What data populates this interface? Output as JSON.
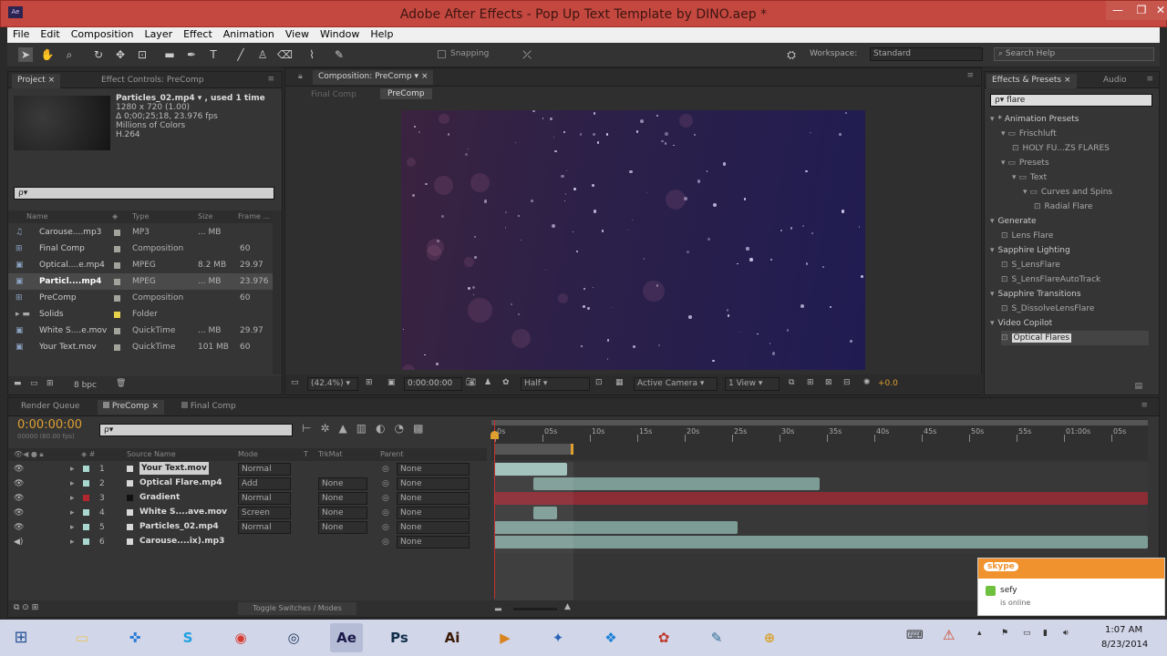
{
  "window": {
    "title": "Adobe After Effects - Pop Up Text Template by DINO.aep *",
    "minimize": "—",
    "maximize": "❐",
    "close": "✕",
    "app_icon": "Ae"
  },
  "menu": [
    "File",
    "Edit",
    "Composition",
    "Layer",
    "Effect",
    "Animation",
    "View",
    "Window",
    "Help"
  ],
  "toolbar": {
    "snapping": "Snapping",
    "workspace_label": "Workspace:",
    "workspace_value": "Standard",
    "search_placeholder": "Search Help"
  },
  "project": {
    "tab": "Project",
    "effect_controls": "Effect Controls: PreComp",
    "preview_info": [
      "Particles_02.mp4 ▾ , used 1 time",
      "1280 x 720 (1.00)",
      "Δ 0;00;25;18, 23.976 fps",
      "Millions of Colors",
      "H.264"
    ],
    "search_placeholder": "ρ▾",
    "columns": [
      "Name",
      "Type",
      "Size",
      "Frame ..."
    ],
    "items": [
      {
        "name": "Carouse....mp3",
        "type": "MP3",
        "size": "... MB",
        "fps": "",
        "color": "#a2a39a",
        "icon": "audio"
      },
      {
        "name": "Final Comp",
        "type": "Composition",
        "size": "",
        "fps": "60",
        "color": "#a2a39a",
        "icon": "comp"
      },
      {
        "name": "Optical....e.mp4",
        "type": "MPEG",
        "size": "8.2 MB",
        "fps": "29.97",
        "color": "#a2a39a",
        "icon": "video"
      },
      {
        "name": "Particl....mp4",
        "type": "MPEG",
        "size": "... MB",
        "fps": "23.976",
        "color": "#a2a39a",
        "icon": "video"
      },
      {
        "name": "PreComp",
        "type": "Composition",
        "size": "",
        "fps": "60",
        "color": "#a2a39a",
        "icon": "comp"
      },
      {
        "name": "Solids",
        "type": "Folder",
        "size": "",
        "fps": "",
        "color": "#e6d24a",
        "icon": "folder"
      },
      {
        "name": "White S....e.mov",
        "type": "QuickTime",
        "size": "... MB",
        "fps": "29.97",
        "color": "#a2a39a",
        "icon": "video"
      },
      {
        "name": "Your Text.mov",
        "type": "QuickTime",
        "size": "101 MB",
        "fps": "60",
        "color": "#a2a39a",
        "icon": "video"
      }
    ],
    "bpc": "8 bpc"
  },
  "composition": {
    "tab": "Composition: PreComp",
    "sub_tabs": [
      "Final Comp",
      "PreComp"
    ],
    "zoom": "(42.4%)",
    "timecode": "0:00:00:00",
    "resolution": "Half",
    "camera": "Active Camera",
    "views": "1 View",
    "exposure": "+0.0"
  },
  "effects": {
    "tab": "Effects & Presets",
    "audio_tab": "Audio",
    "search_value": "flare",
    "tree": [
      {
        "label": "* Animation Presets",
        "indent": 0,
        "kind": "group"
      },
      {
        "label": "Frischluft",
        "indent": 1,
        "kind": "folder"
      },
      {
        "label": "HOLY FU...ZS FLARES",
        "indent": 2,
        "kind": "preset"
      },
      {
        "label": "Presets",
        "indent": 1,
        "kind": "folder"
      },
      {
        "label": "Text",
        "indent": 2,
        "kind": "folder"
      },
      {
        "label": "Curves and Spins",
        "indent": 3,
        "kind": "folder"
      },
      {
        "label": "Radial Flare",
        "indent": 4,
        "kind": "preset"
      },
      {
        "label": "Generate",
        "indent": 0,
        "kind": "group"
      },
      {
        "label": "Lens Flare",
        "indent": 1,
        "kind": "effect"
      },
      {
        "label": "Sapphire Lighting",
        "indent": 0,
        "kind": "group"
      },
      {
        "label": "S_LensFlare",
        "indent": 1,
        "kind": "effect"
      },
      {
        "label": "S_LensFlareAutoTrack",
        "indent": 1,
        "kind": "effect"
      },
      {
        "label": "Sapphire Transitions",
        "indent": 0,
        "kind": "group"
      },
      {
        "label": "S_DissolveLensFlare",
        "indent": 1,
        "kind": "effect"
      },
      {
        "label": "Video Copilot",
        "indent": 0,
        "kind": "group"
      },
      {
        "label": "Optical Flares",
        "indent": 1,
        "kind": "effect",
        "selected": true
      }
    ]
  },
  "timeline": {
    "tabs": [
      "Render Queue",
      "PreComp",
      "Final Comp"
    ],
    "timecode": "0:00:00:00",
    "fps_note": "00000 (60.00 fps)",
    "columns": [
      "Source Name",
      "Mode",
      "T",
      "TrkMat",
      "Parent"
    ],
    "ruler": [
      "0s",
      "05s",
      "10s",
      "15s",
      "20s",
      "25s",
      "30s",
      "35s",
      "40s",
      "45s",
      "50s",
      "55s",
      "01:00s",
      "05s"
    ],
    "layers": [
      {
        "num": "1",
        "name": "Your Text.mov",
        "mode": "Normal",
        "trkmat": "",
        "parent": "None",
        "label": "#a8d7cf",
        "start": 0.0,
        "end": 0.115,
        "bar": "#9fbfbb"
      },
      {
        "num": "2",
        "name": "Optical Flare.mp4",
        "mode": "Add",
        "trkmat": "None",
        "parent": "None",
        "label": "#a8d7cf",
        "start": 0.06,
        "end": 0.5,
        "bar": "#7e9c96"
      },
      {
        "num": "3",
        "name": "Gradient",
        "mode": "Normal",
        "trkmat": "None",
        "parent": "None",
        "label": "#b3262e",
        "start": 0.0,
        "end": 1.0,
        "bar": "#8c2c35"
      },
      {
        "num": "4",
        "name": "White S....ave.mov",
        "mode": "Screen",
        "trkmat": "None",
        "parent": "None",
        "label": "#a8d7cf",
        "start": 0.06,
        "end": 0.1,
        "bar": "#7e9c96"
      },
      {
        "num": "5",
        "name": "Particles_02.mp4",
        "mode": "Normal",
        "trkmat": "None",
        "parent": "None",
        "label": "#a8d7cf",
        "start": 0.0,
        "end": 0.375,
        "bar": "#7e9c96"
      },
      {
        "num": "6",
        "name": "Carouse....ix).mp3",
        "mode": "",
        "trkmat": "",
        "parent": "None",
        "label": "#a8d7cf",
        "start": -0.01,
        "end": 1.0,
        "bar": "#7e9c96"
      }
    ],
    "toggle": "Toggle Switches / Modes"
  },
  "skype": {
    "logo": "skype",
    "user": "sefy",
    "status": "is online"
  },
  "taskbar": {
    "time": "1:07 AM",
    "date": "8/23/2014",
    "apps": [
      {
        "name": "folder-icon",
        "g": "▭",
        "c": "#e9c55b"
      },
      {
        "name": "sniper-icon",
        "g": "✜",
        "c": "#2b7bd6"
      },
      {
        "name": "skype-icon",
        "g": "S",
        "c": "#1fa0e3"
      },
      {
        "name": "chrome-icon",
        "g": "◉",
        "c": "#d83b2f"
      },
      {
        "name": "cinema4d-icon",
        "g": "◎",
        "c": "#22395e"
      },
      {
        "name": "aftereffects-icon",
        "g": "Ae",
        "c": "#1a1847"
      },
      {
        "name": "photoshop-icon",
        "g": "Ps",
        "c": "#0f2d4a"
      },
      {
        "name": "illustrator-icon",
        "g": "Ai",
        "c": "#3b1a08"
      },
      {
        "name": "media-player-icon",
        "g": "▶",
        "c": "#d9841f"
      },
      {
        "name": "bird-icon",
        "g": "✦",
        "c": "#2a64b8"
      },
      {
        "name": "dropbox-icon",
        "g": "❖",
        "c": "#1a80d8"
      },
      {
        "name": "flower-icon",
        "g": "✿",
        "c": "#c0392b"
      },
      {
        "name": "pen-icon",
        "g": "✎",
        "c": "#2f6d94"
      },
      {
        "name": "network-icon",
        "g": "⊕",
        "c": "#d8a12a"
      }
    ]
  }
}
